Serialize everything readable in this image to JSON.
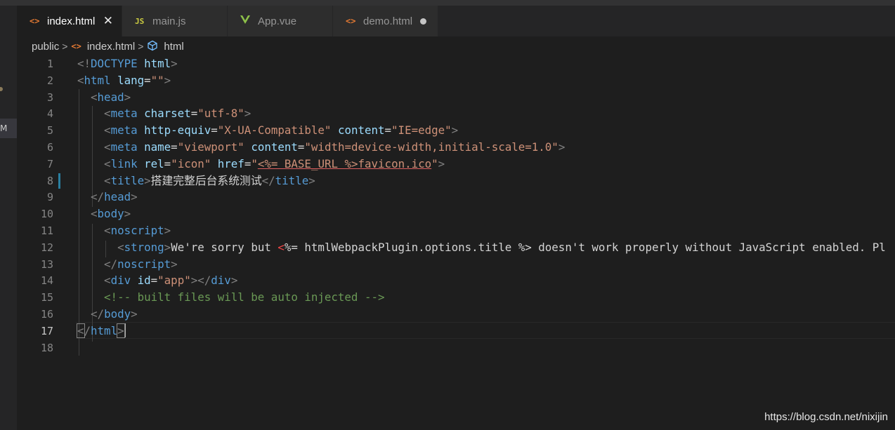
{
  "tabs": [
    {
      "label": "index.html",
      "icon": "html-file-icon",
      "icon_glyph": "<>",
      "icon_color": "#e37933",
      "active": true,
      "close": "✕"
    },
    {
      "label": "main.js",
      "icon": "js-file-icon",
      "icon_glyph": "JS",
      "icon_color": "#cbcb41",
      "active": false
    },
    {
      "label": "App.vue",
      "icon": "vue-file-icon",
      "icon_glyph": "V",
      "icon_color": "#8dc149",
      "active": false
    },
    {
      "label": "demo.html",
      "icon": "html-file-icon",
      "icon_glyph": "<>",
      "icon_color": "#e37933",
      "active": false,
      "dirty": true
    }
  ],
  "activity_bar": {
    "badge": "M"
  },
  "breadcrumb": {
    "folder": "public",
    "file": "index.html",
    "file_icon_glyph": "<>",
    "symbol": "html",
    "symbol_icon_glyph": "⬡",
    "separator": ">"
  },
  "editor": {
    "current_line": 17,
    "lines": [
      {
        "n": "1",
        "tokens": [
          [
            "t-punct",
            "<!"
          ],
          [
            "t-doctype",
            "DOCTYPE "
          ],
          [
            "t-attr",
            "html"
          ],
          [
            "t-punct",
            ">"
          ]
        ]
      },
      {
        "n": "2",
        "tokens": [
          [
            "t-punct",
            "<"
          ],
          [
            "t-tag",
            "html "
          ],
          [
            "t-attr",
            "lang"
          ],
          [
            "t-text",
            "="
          ],
          [
            "t-str",
            "\"\""
          ],
          [
            "t-punct",
            ">"
          ]
        ]
      },
      {
        "n": "3",
        "tokens": [
          [
            "t-text",
            "  "
          ],
          [
            "t-punct",
            "<"
          ],
          [
            "t-tag",
            "head"
          ],
          [
            "t-punct",
            ">"
          ]
        ]
      },
      {
        "n": "4",
        "tokens": [
          [
            "t-text",
            "    "
          ],
          [
            "t-punct",
            "<"
          ],
          [
            "t-tag",
            "meta "
          ],
          [
            "t-attr",
            "charset"
          ],
          [
            "t-text",
            "="
          ],
          [
            "t-str",
            "\"utf-8\""
          ],
          [
            "t-punct",
            ">"
          ]
        ]
      },
      {
        "n": "5",
        "tokens": [
          [
            "t-text",
            "    "
          ],
          [
            "t-punct",
            "<"
          ],
          [
            "t-tag",
            "meta "
          ],
          [
            "t-attr",
            "http-equiv"
          ],
          [
            "t-text",
            "="
          ],
          [
            "t-str",
            "\"X-UA-Compatible\""
          ],
          [
            "t-text",
            " "
          ],
          [
            "t-attr",
            "content"
          ],
          [
            "t-text",
            "="
          ],
          [
            "t-str",
            "\"IE=edge\""
          ],
          [
            "t-punct",
            ">"
          ]
        ]
      },
      {
        "n": "6",
        "tokens": [
          [
            "t-text",
            "    "
          ],
          [
            "t-punct",
            "<"
          ],
          [
            "t-tag",
            "meta "
          ],
          [
            "t-attr",
            "name"
          ],
          [
            "t-text",
            "="
          ],
          [
            "t-str",
            "\"viewport\""
          ],
          [
            "t-text",
            " "
          ],
          [
            "t-attr",
            "content"
          ],
          [
            "t-text",
            "="
          ],
          [
            "t-str",
            "\"width=device-width,initial-scale=1.0\""
          ],
          [
            "t-punct",
            ">"
          ]
        ]
      },
      {
        "n": "7",
        "tokens": [
          [
            "t-text",
            "    "
          ],
          [
            "t-punct",
            "<"
          ],
          [
            "t-tag",
            "link "
          ],
          [
            "t-attr",
            "rel"
          ],
          [
            "t-text",
            "="
          ],
          [
            "t-str",
            "\"icon\""
          ],
          [
            "t-text",
            " "
          ],
          [
            "t-attr",
            "href"
          ],
          [
            "t-text",
            "="
          ],
          [
            "t-str",
            "\""
          ],
          [
            "t-err",
            "<%= BASE_URL %>favicon.ico"
          ],
          [
            "t-str",
            "\""
          ],
          [
            "t-punct",
            ">"
          ]
        ]
      },
      {
        "n": "8",
        "tokens": [
          [
            "t-text",
            "    "
          ],
          [
            "t-punct",
            "<"
          ],
          [
            "t-tag",
            "title"
          ],
          [
            "t-punct",
            ">"
          ],
          [
            "t-text",
            "搭建完整后台系统测试"
          ],
          [
            "t-punct",
            "</"
          ],
          [
            "t-tag",
            "title"
          ],
          [
            "t-punct",
            ">"
          ]
        ]
      },
      {
        "n": "9",
        "tokens": [
          [
            "t-text",
            "  "
          ],
          [
            "t-punct",
            "</"
          ],
          [
            "t-tag",
            "head"
          ],
          [
            "t-punct",
            ">"
          ]
        ]
      },
      {
        "n": "10",
        "tokens": [
          [
            "t-text",
            "  "
          ],
          [
            "t-punct",
            "<"
          ],
          [
            "t-tag",
            "body"
          ],
          [
            "t-punct",
            ">"
          ]
        ]
      },
      {
        "n": "11",
        "tokens": [
          [
            "t-text",
            "    "
          ],
          [
            "t-punct",
            "<"
          ],
          [
            "t-tag",
            "noscript"
          ],
          [
            "t-punct",
            ">"
          ]
        ]
      },
      {
        "n": "12",
        "tokens": [
          [
            "t-text",
            "      "
          ],
          [
            "t-punct",
            "<"
          ],
          [
            "t-tag",
            "strong"
          ],
          [
            "t-punct",
            ">"
          ],
          [
            "t-text",
            "We're sorry but "
          ],
          [
            "t-tpl",
            "<"
          ],
          [
            "t-text",
            "%= htmlWebpackPlugin.options.title %> doesn't work properly without JavaScript enabled. Pl"
          ]
        ]
      },
      {
        "n": "13",
        "tokens": [
          [
            "t-text",
            "    "
          ],
          [
            "t-punct",
            "</"
          ],
          [
            "t-tag",
            "noscript"
          ],
          [
            "t-punct",
            ">"
          ]
        ]
      },
      {
        "n": "14",
        "tokens": [
          [
            "t-text",
            "    "
          ],
          [
            "t-punct",
            "<"
          ],
          [
            "t-tag",
            "div "
          ],
          [
            "t-attr",
            "id"
          ],
          [
            "t-text",
            "="
          ],
          [
            "t-str",
            "\"app\""
          ],
          [
            "t-punct",
            "></"
          ],
          [
            "t-tag",
            "div"
          ],
          [
            "t-punct",
            ">"
          ]
        ]
      },
      {
        "n": "15",
        "tokens": [
          [
            "t-text",
            "    "
          ],
          [
            "t-comment",
            "<!-- built files will be auto injected -->"
          ]
        ]
      },
      {
        "n": "16",
        "tokens": [
          [
            "t-text",
            "  "
          ],
          [
            "t-punct",
            "</"
          ],
          [
            "t-tag",
            "body"
          ],
          [
            "t-punct",
            ">"
          ]
        ]
      },
      {
        "n": "17",
        "tokens": [
          [
            "t-punct t-brk",
            "<"
          ],
          [
            "t-punct",
            "/"
          ],
          [
            "t-tag",
            "html"
          ],
          [
            "t-punct t-brk",
            ">"
          ]
        ]
      },
      {
        "n": "18",
        "tokens": []
      }
    ]
  },
  "watermark": "https://blog.csdn.net/nixijin"
}
